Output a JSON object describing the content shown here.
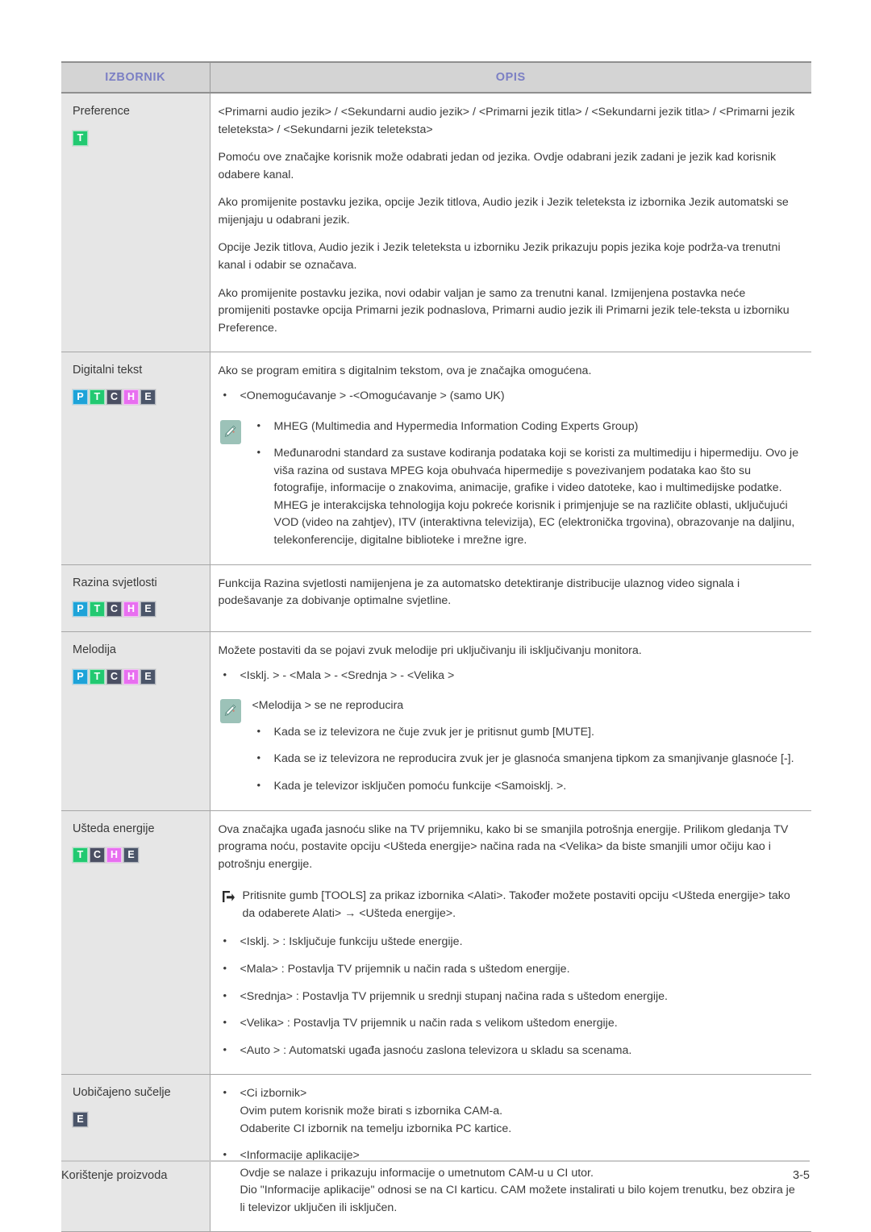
{
  "table": {
    "headers": {
      "menu": "IZBORNIK",
      "description": "OPIS"
    },
    "header_text_color": "#7b7fc4",
    "header_bg_color": "#d4d4d4",
    "menu_cell_bg_color": "#e6e6e6"
  },
  "badge_colors": {
    "P": "#1ea3d8",
    "T": "#22c971",
    "C": "#4b4f63",
    "H": "#e86ff0",
    "E": "#4b5569"
  },
  "rows": [
    {
      "menu": "Preference",
      "badges": [
        "T"
      ],
      "paragraphs": [
        "<Primarni audio jezik> / <Sekundarni audio jezik> / <Primarni jezik titla> / <Sekundarni jezik titla> / <Primarni jezik teleteksta> / <Sekundarni jezik teleteksta>",
        "Pomoću ove značajke korisnik može odabrati jedan od jezika. Ovdje odabrani jezik zadani je jezik kad korisnik odabere kanal.",
        "Ako promijenite postavku jezika, opcije Jezik titlova, Audio jezik i Jezik teleteksta iz izbornika Jezik automatski se mijenjaju u odabrani jezik.",
        "Opcije Jezik titlova, Audio jezik i Jezik teleteksta u izborniku Jezik prikazuju popis jezika koje podrža-va trenutni kanal i odabir se označava.",
        "Ako promijenite postavku jezika, novi odabir valjan je samo za trenutni kanal. Izmijenjena postavka neće promijeniti postavke opcija Primarni jezik podnaslova, Primarni audio jezik ili Primarni jezik tele-teksta u izborniku Preference."
      ]
    },
    {
      "menu": "Digitalni tekst",
      "badges": [
        "P",
        "T",
        "C",
        "H",
        "E"
      ],
      "intro": "Ako se program emitira s digitalnim tekstom, ova je značajka omogućena.",
      "bullets": [
        "<Onemogućavanje > -<Omogućavanje > (samo UK)"
      ],
      "note": {
        "icon": "pencil-note-icon",
        "bullets": [
          "MHEG (Multimedia and Hypermedia Information Coding Experts Group)",
          "Međunarodni standard za sustave kodiranja podataka koji se koristi za multimediju i hipermediju. Ovo je viša razina od sustava MPEG koja obuhvaća hipermedije s povezivanjem podataka kao što su fotografije, informacije o znakovima, animacije, grafike i video datoteke, kao i multimedijske podatke. MHEG je interakcijska tehnologija koju pokreće korisnik i primjenjuje se na različite oblasti, uključujući VOD (video na zahtjev), ITV (interaktivna televizija), EC (elektronička trgovina), obrazovanje na daljinu, telekonferencije, digitalne biblioteke i mrežne igre."
        ]
      }
    },
    {
      "menu": "Razina svjetlosti",
      "badges": [
        "P",
        "T",
        "C",
        "H",
        "E"
      ],
      "intro": "Funkcija Razina svjetlosti namijenjena je za automatsko detektiranje distribucije ulaznog video signala i podešavanje za dobivanje optimalne svjetline."
    },
    {
      "menu": "Melodija",
      "badges": [
        "P",
        "T",
        "C",
        "H",
        "E"
      ],
      "intro": "Možete postaviti da se pojavi zvuk melodije pri uključivanju ili isključivanju monitora.",
      "bullets": [
        "<Isklj. > - <Mala > - <Srednja > - <Velika >"
      ],
      "note": {
        "icon": "pencil-note-icon",
        "title": "<Melodija > se ne reproducira",
        "bullets": [
          "Kada se iz televizora ne čuje zvuk jer je pritisnut gumb [MUTE].",
          "Kada se iz televizora ne reproducira zvuk jer je glasnoća smanjena tipkom za smanjivanje glasnoće [-].",
          "Kada je televizor isključen pomoću funkcije <Samoisklj. >."
        ]
      }
    },
    {
      "menu": "Ušteda energije",
      "badges": [
        "T",
        "C",
        "H",
        "E"
      ],
      "intro": "Ova značajka ugađa jasnoću slike na TV prijemniku, kako bi se smanjila potrošnja energije. Prilikom gledanja TV programa noću, postavite opciju <Ušteda energije> načina rada na <Velika> da biste smanjili umor očiju kao i potrošnju energije.",
      "tools_note": {
        "icon": "tools-button-icon",
        "text": "Pritisnite gumb [TOOLS] za prikaz izbornika <Alati>. Također možete postaviti opciju <Ušteda energije> tako da odaberete Alati> → <Ušteda energije>."
      },
      "bullets": [
        "<Isklj. > : Isključuje funkciju uštede energije.",
        "<Mala> : Postavlja TV prijemnik u način rada s uštedom energije.",
        "<Srednja> : Postavlja TV prijemnik u srednji stupanj načina rada s uštedom energije.",
        "<Velika> : Postavlja TV prijemnik u način rada s velikom uštedom energije.",
        "<Auto > : Automatski ugađa jasnoću zaslona televizora u skladu sa scenama."
      ]
    },
    {
      "menu": "Uobičajeno sučelje",
      "badges": [
        "E"
      ],
      "bullet_groups": [
        {
          "bullet": "<Ci izbornik>",
          "lines": [
            "Ovim putem korisnik može birati s izbornika CAM-a.",
            "Odaberite CI izbornik na temelju izbornika PC kartice."
          ]
        },
        {
          "bullet": "<Informacije aplikacije>",
          "lines": [
            "Ovdje se nalaze i prikazuju informacije o umetnutom CAM-u u CI utor.",
            "Dio \"Informacije aplikacije\" odnosi se na CI karticu. CAM možete instalirati u bilo kojem trenutku, bez obzira je li televizor uključen ili isključen."
          ]
        }
      ]
    }
  ],
  "footer": {
    "left": "Korištenje proizvoda",
    "right": "3-5"
  }
}
